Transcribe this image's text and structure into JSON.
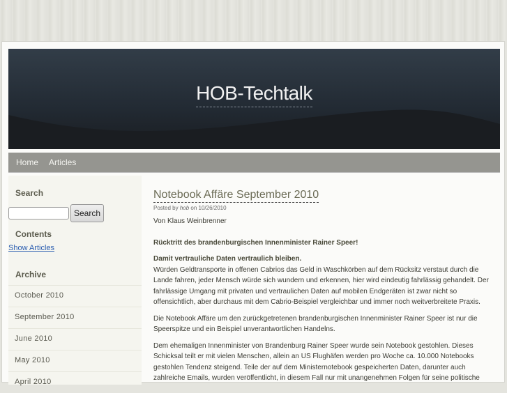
{
  "site": {
    "title": "HOB-Techtalk"
  },
  "nav": {
    "items": [
      "Home",
      "Articles"
    ]
  },
  "sidebar": {
    "search_heading": "Search",
    "search_button": "Search",
    "search_value": "",
    "contents_heading": "Contents",
    "show_articles": "Show Articles",
    "archive_heading": "Archive",
    "archive": [
      "October 2010",
      "September 2010",
      "June 2010",
      "May 2010",
      "April 2010"
    ]
  },
  "post": {
    "title": "Notebook Affäre September 2010",
    "posted_by": "Posted by",
    "author": "hob",
    "on": "on 10/26/2010",
    "paragraphs": [
      "Von Klaus Weinbrenner",
      "Rücktritt des brandenburgischen Innenminister Rainer Speer!",
      "Damit vertrauliche Daten vertraulich bleiben.",
      "Würden Geldtransporte in offenen Cabrios das Geld in Waschkörben auf dem Rücksitz verstaut durch die Lande fahren, jeder Mensch würde sich wundern und erkennen, hier wird eindeutig fahrlässig gehandelt. Der fahrlässige Umgang mit privaten und vertraulichen Daten auf mobilen Endgeräten ist zwar nicht so offensichtlich, aber durchaus mit dem Cabrio-Beispiel vergleichbar und immer noch weitverbreitete Praxis.",
      "Die Notebook Affäre um den zurückgetretenen brandenburgischen Innenminister Rainer Speer ist nur die Speerspitze und ein Beispiel unverantwortlichen Handelns.",
      "Dem ehemaligen Innenminister von Brandenburg Rainer Speer wurde sein Notebook gestohlen. Dieses Schicksal teilt er mit vielen Menschen, allein an US Flughäfen werden pro Woche ca. 10.000 Notebooks gestohlen Tendenz steigend. Teile der auf dem Ministernotebook gespeicherten Daten, darunter auch zahlreiche Emails, wurden veröffentlicht, in diesem Fall nur mit unangenehmen Folgen für seine politische"
    ]
  }
}
